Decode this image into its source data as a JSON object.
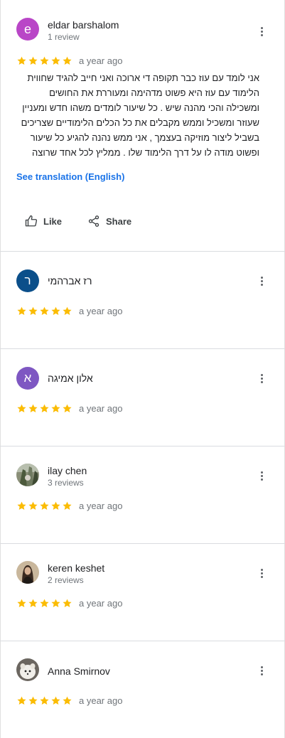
{
  "colors": {
    "star": "#fbbc04",
    "link": "#1a73e8",
    "avatar_e": "#b946c7",
    "avatar_r": "#0b4f8a",
    "avatar_a": "#7e57c2"
  },
  "reviews": [
    {
      "name": "eldar barshalom",
      "count": "1 review",
      "avatar_letter": "e",
      "time": "a year ago",
      "text_lines": [
        "אני לומד עם עוז כבר תקופה די ארוכה ואני חייב להגיד שחווית",
        "הלימוד עם עוז היא פשוט מדהימה ומעוררת את החושים",
        "ומשכילה והכי מהנה שיש . כל שיעור לומדים משהו חדש ומעניין",
        "שעוזר ומשכיל וממש מקבלים את כל הכלים הלימודיים שצריכים",
        "בשביל ליצור מוזיקה בעצמך , אני ממש נהנה להגיע כל שיעור",
        "ופשוט מודה לו על דרך הלימוד שלו . ממליץ לכל אחד שרוצה"
      ],
      "translate": "See translation (English)",
      "like": "Like",
      "share": "Share"
    },
    {
      "name": "רז אברהמי",
      "avatar_letter": "ר",
      "time": "a year ago"
    },
    {
      "name": "אלון אמיגה",
      "avatar_letter": "א",
      "time": "a year ago"
    },
    {
      "name": "ilay chen",
      "count": "3 reviews",
      "time": "a year ago"
    },
    {
      "name": "keren keshet",
      "count": "2 reviews",
      "time": "a year ago"
    },
    {
      "name": "Anna Smirnov",
      "time": "a year ago"
    }
  ],
  "rating_stars": 5
}
